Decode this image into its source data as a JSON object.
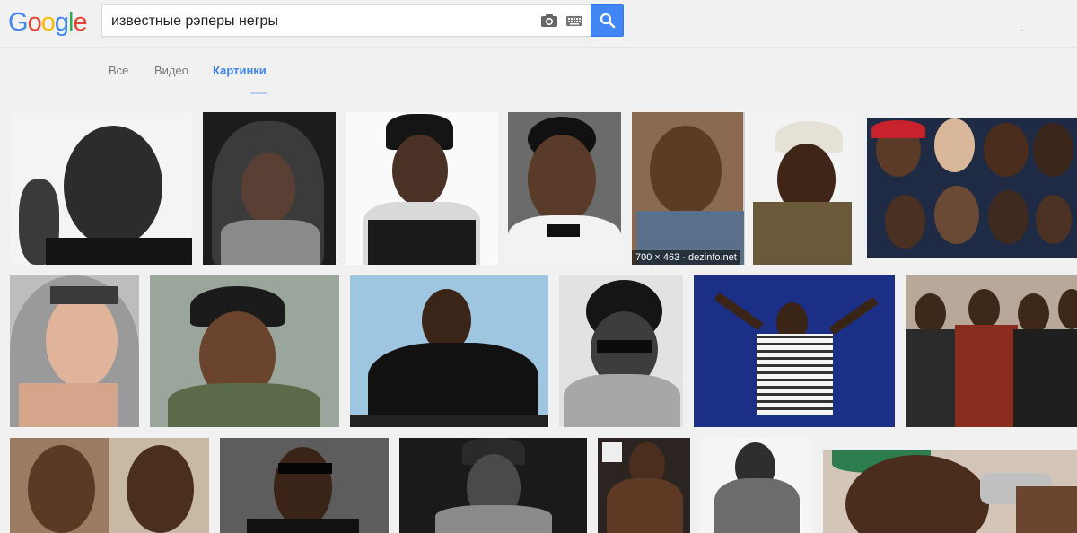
{
  "logo": {
    "letters": [
      "G",
      "o",
      "o",
      "g",
      "l",
      "e"
    ],
    "colors": [
      "#4285f4",
      "#ea4335",
      "#fbbc05",
      "#4285f4",
      "#34a853",
      "#ea4335"
    ]
  },
  "search": {
    "query": "известные рэперы негры",
    "camera_icon": "camera-icon",
    "keyboard_icon": "keyboard-icon",
    "search_icon": "magnifier-icon",
    "button_color": "#4285f4"
  },
  "tabs": [
    {
      "label": "Все",
      "active": false
    },
    {
      "label": "Видео",
      "active": false
    },
    {
      "label": "Картинки",
      "active": true
    }
  ],
  "results": {
    "hover_caption": "700 × 463 - dezinfo.net"
  },
  "colors": {
    "accent": "#4285f4",
    "page_bg": "#f1f1f1"
  }
}
